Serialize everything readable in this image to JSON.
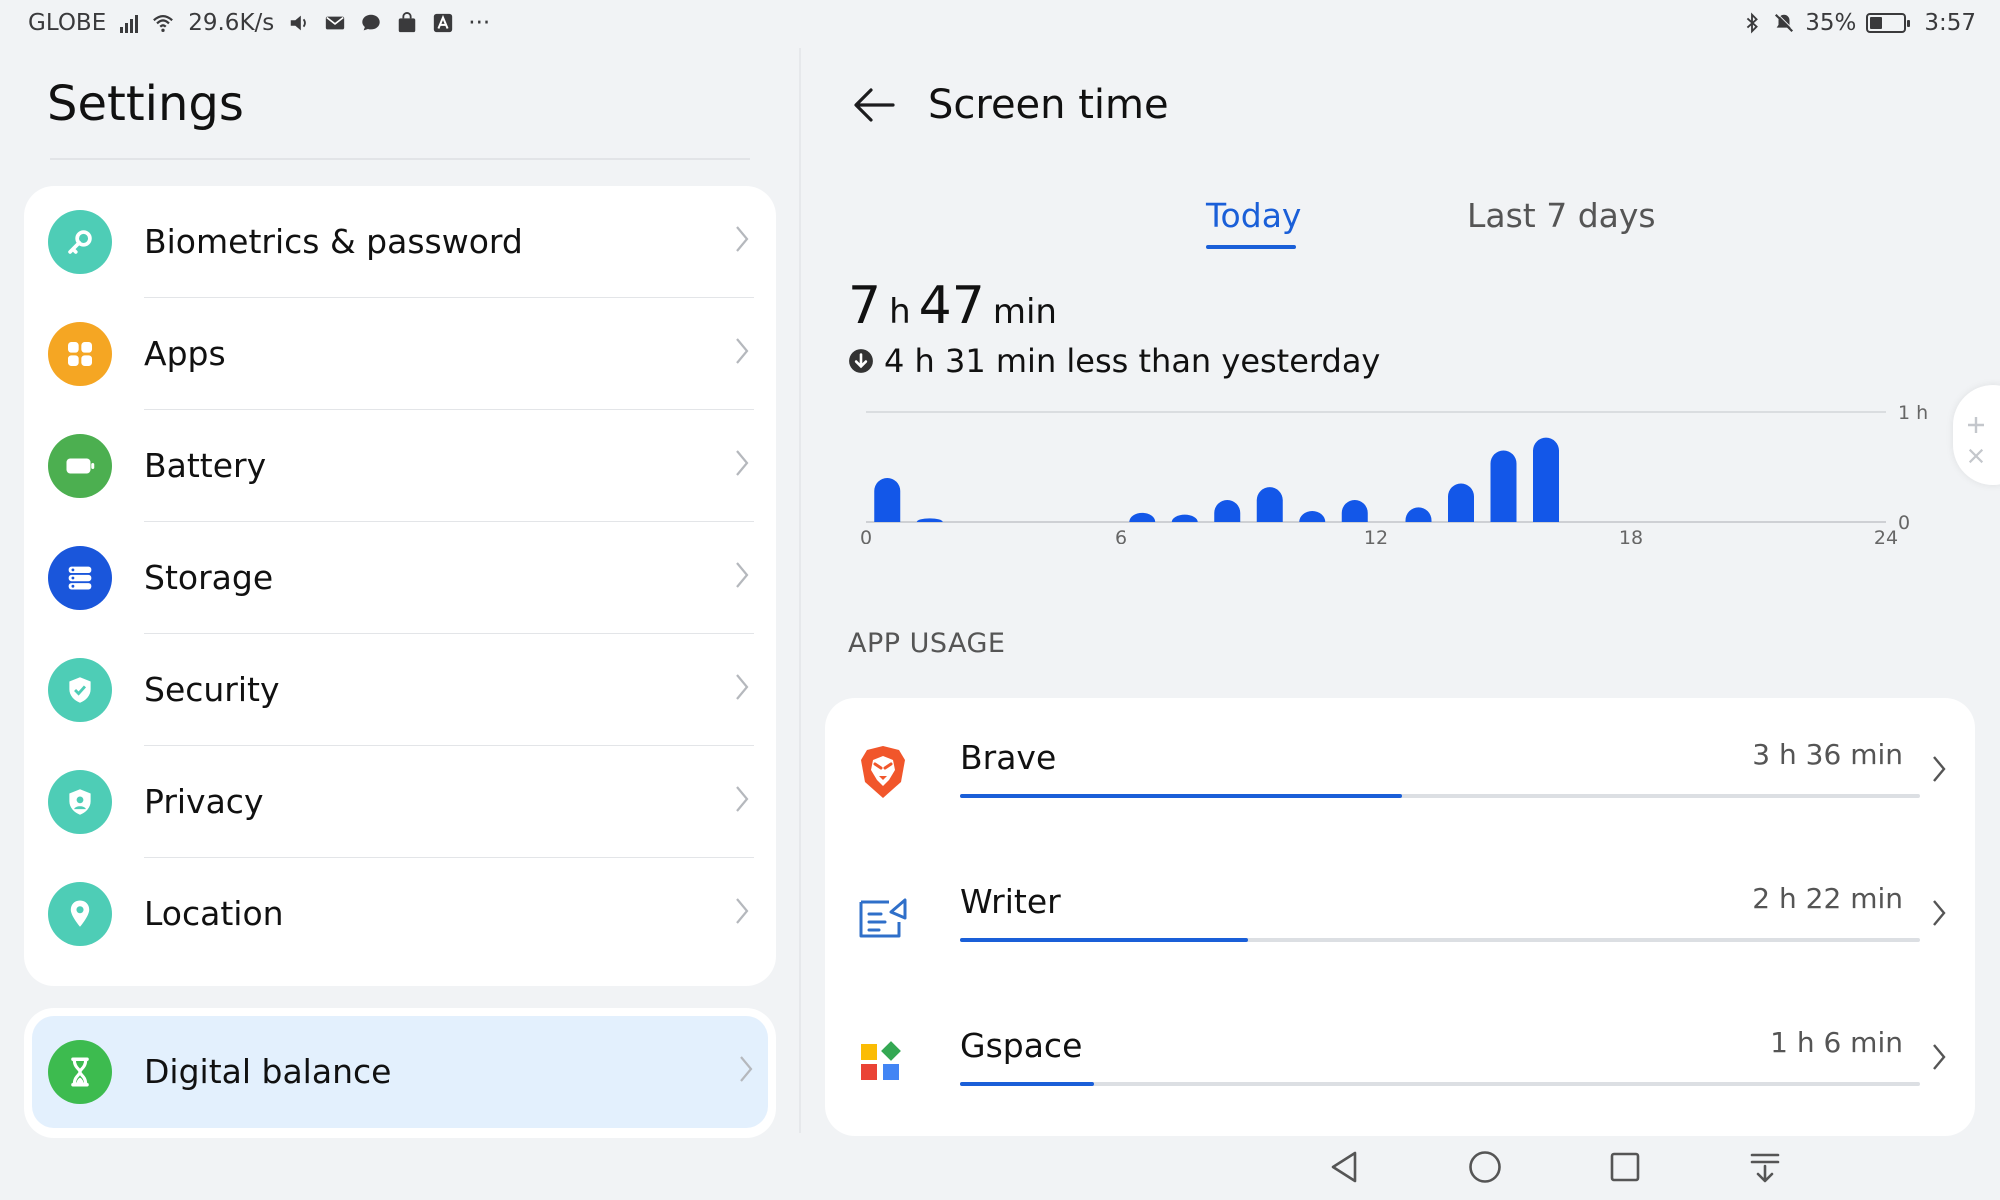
{
  "status_bar": {
    "carrier": "GLOBE",
    "speed": "29.6K/s",
    "battery_percent": "35%",
    "battery_level": 0.35,
    "time": "3:57",
    "more": "···"
  },
  "settings": {
    "title": "Settings",
    "items": [
      {
        "label": "Biometrics & password",
        "icon": "key-icon",
        "color": "#4ecdb6"
      },
      {
        "label": "Apps",
        "icon": "apps-grid-icon",
        "color": "#f5a623"
      },
      {
        "label": "Battery",
        "icon": "battery-icon",
        "color": "#4caf50"
      },
      {
        "label": "Storage",
        "icon": "storage-icon",
        "color": "#1a56db"
      },
      {
        "label": "Security",
        "icon": "shield-check-icon",
        "color": "#4ecdb6"
      },
      {
        "label": "Privacy",
        "icon": "privacy-shield-icon",
        "color": "#4ecdb6"
      },
      {
        "label": "Location",
        "icon": "location-pin-icon",
        "color": "#4ecdb6"
      }
    ],
    "digital_balance": {
      "label": "Digital balance",
      "icon": "hourglass-icon",
      "color": "#3dbb4f"
    }
  },
  "screen_time": {
    "title": "Screen time",
    "tabs": [
      "Today",
      "Last 7 days"
    ],
    "active_tab": "Today",
    "total_hours": "7",
    "total_minutes": "47",
    "unit_h": "h",
    "unit_min": "min",
    "comparison": "4 h 31 min less than yesterday",
    "usage_header": "APP USAGE",
    "apps": [
      {
        "name": "Brave",
        "time": "3 h 36 min",
        "share": 0.46,
        "icon": "brave-lion-icon"
      },
      {
        "name": "Writer",
        "time": "2 h 22 min",
        "share": 0.3,
        "icon": "writer-icon"
      },
      {
        "name": "Gspace",
        "time": "1 h 6 min",
        "share": 0.14,
        "icon": "gspace-icon"
      }
    ]
  },
  "chart_data": {
    "type": "bar",
    "x_ticks": [
      "0",
      "6",
      "12",
      "18",
      "24"
    ],
    "y_ticks": [
      "0",
      "1 h"
    ],
    "ylim": [
      0,
      60
    ],
    "xlim": [
      0,
      24
    ],
    "x": [
      0.5,
      1.5,
      6.5,
      7.5,
      8.5,
      9.5,
      10.5,
      11.5,
      13,
      14,
      15,
      16
    ],
    "values": [
      24,
      2,
      5,
      4,
      12,
      19,
      6,
      12,
      8,
      21,
      39,
      46
    ],
    "bar_color": "#1357e8",
    "grid": false
  },
  "colors": {
    "accent": "#1a5fd8",
    "highlight": "#e3f0fd"
  }
}
